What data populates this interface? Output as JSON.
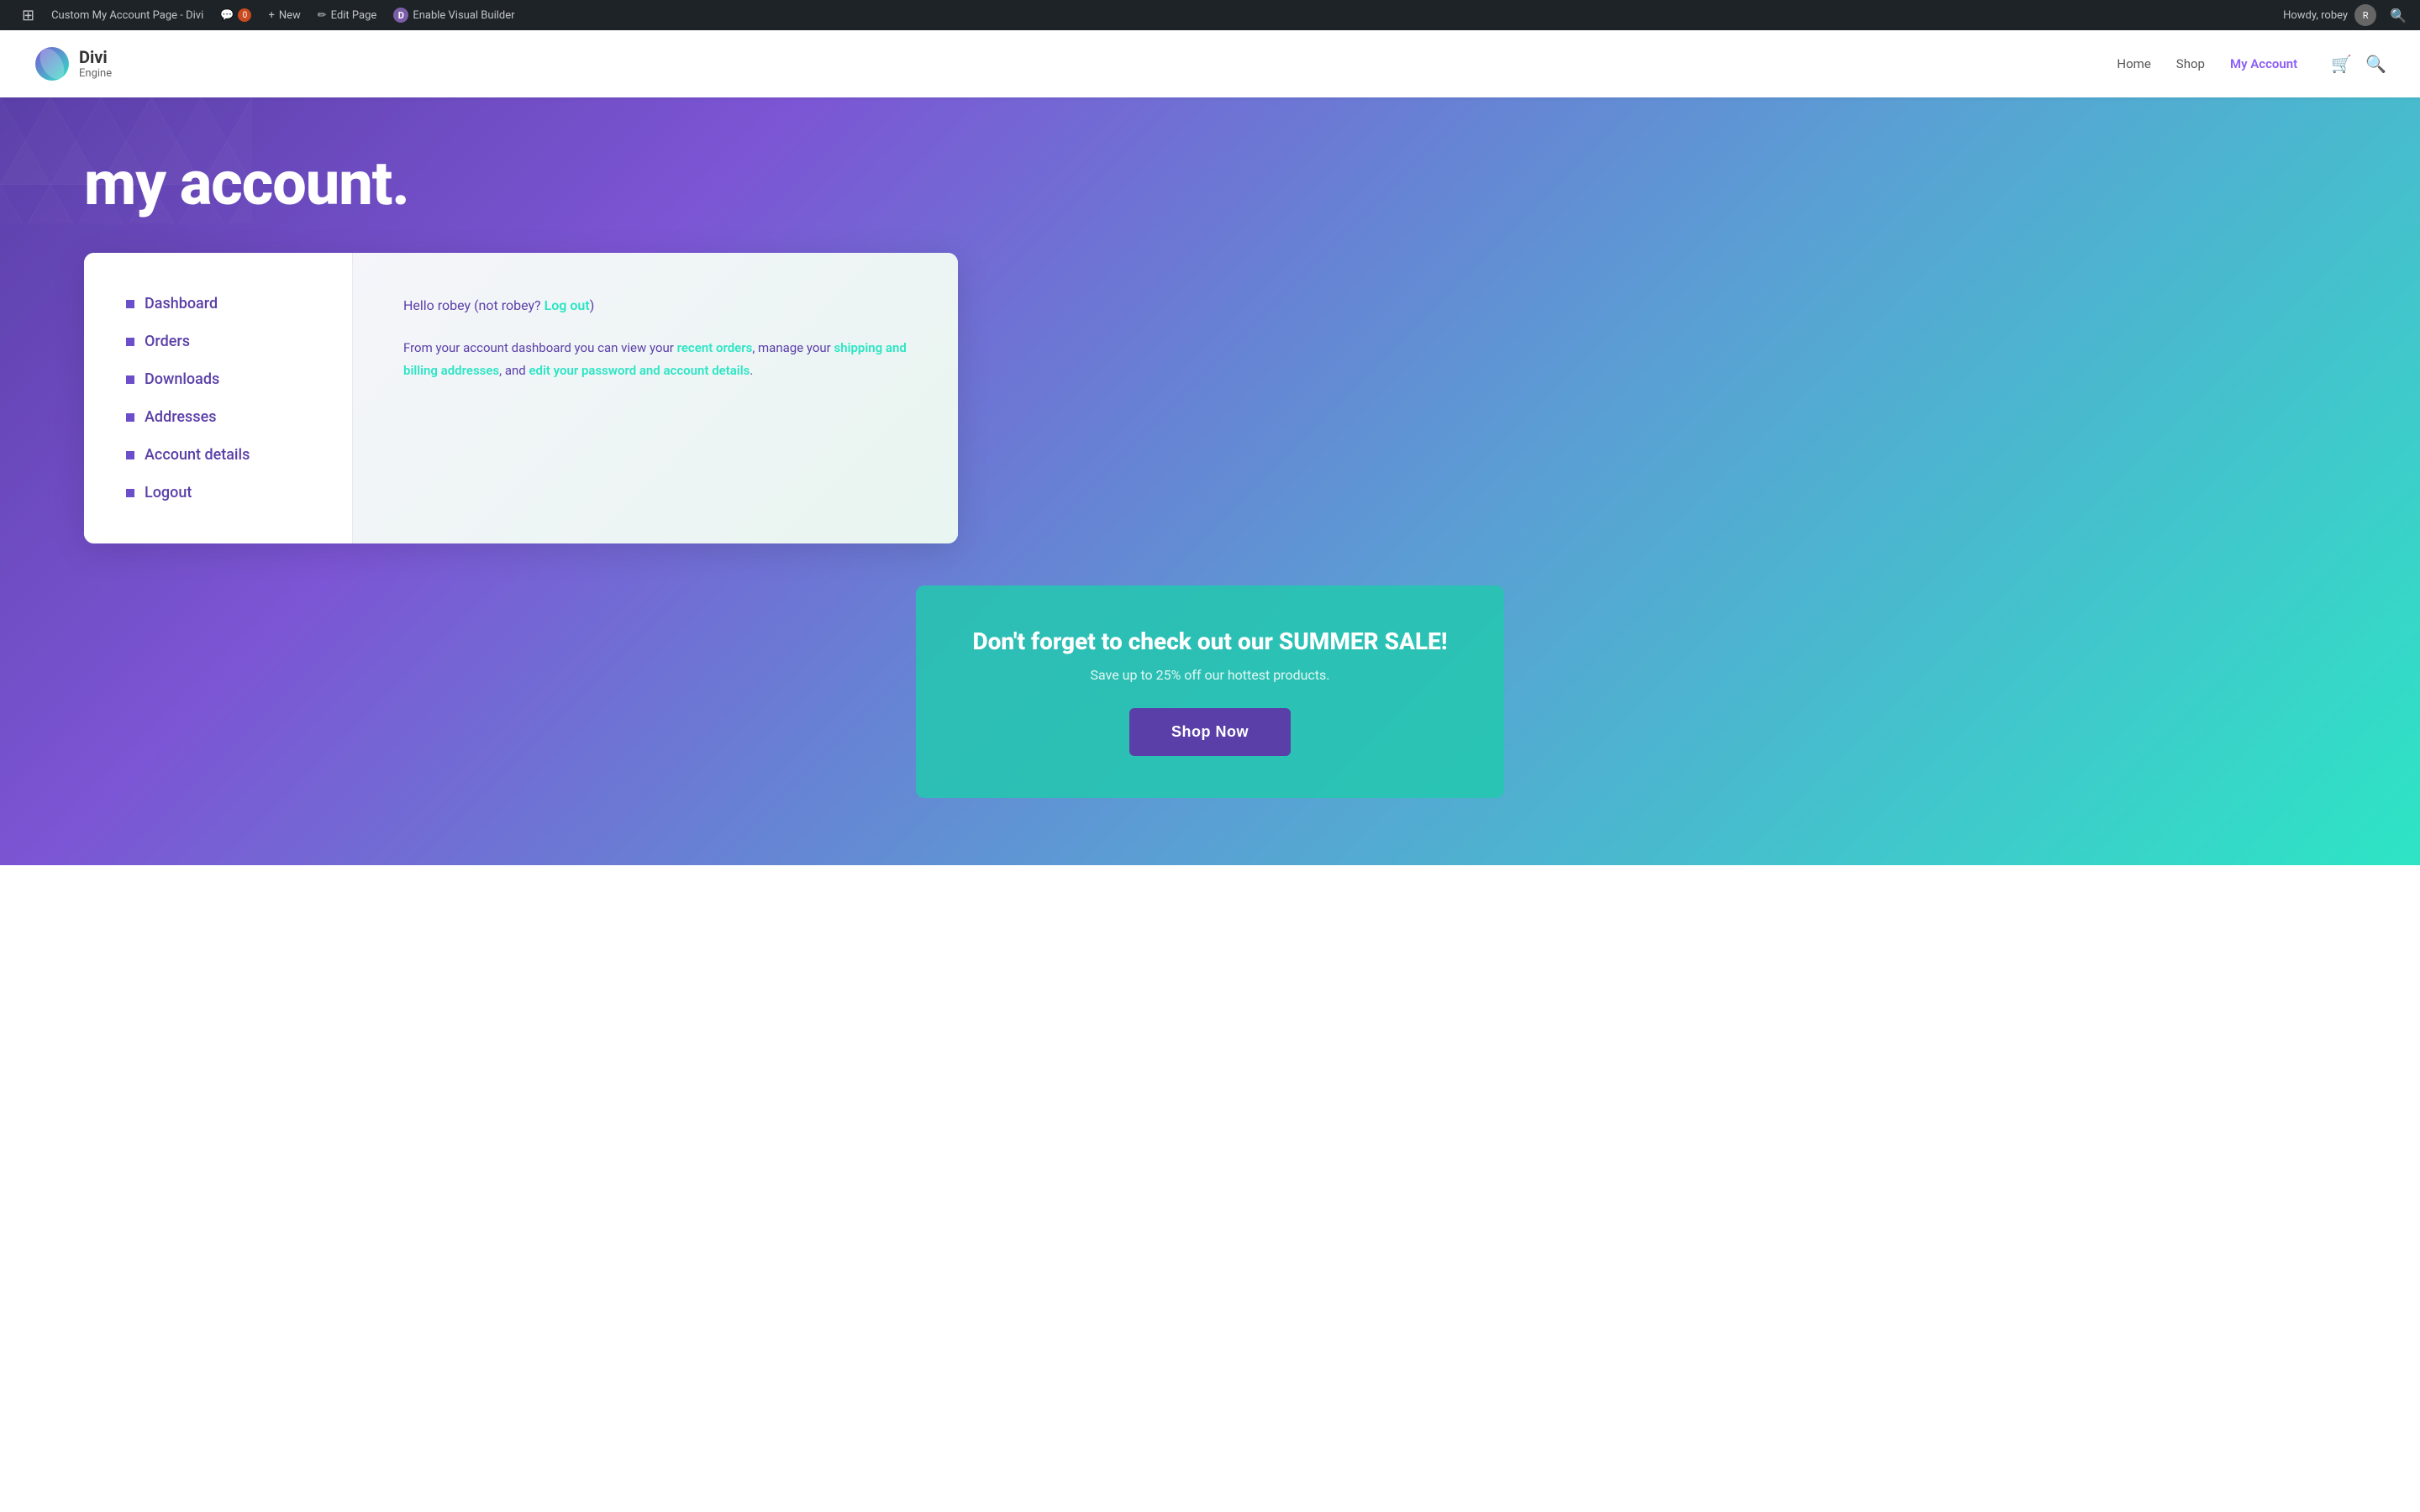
{
  "adminBar": {
    "title": "Custom My Account Page - Divi",
    "items": [
      {
        "id": "wp-logo",
        "label": "WordPress",
        "icon": "⊞"
      },
      {
        "id": "site-name",
        "label": "Custom My Account Page - Divi",
        "icon": ""
      },
      {
        "id": "comments",
        "label": "0",
        "icon": "💬"
      },
      {
        "id": "new",
        "label": "New",
        "icon": "+"
      },
      {
        "id": "edit-page",
        "label": "Edit Page",
        "icon": "✏"
      },
      {
        "id": "divi",
        "label": "Enable Visual Builder",
        "icon": "D"
      }
    ],
    "right": {
      "howdy": "Howdy, robey",
      "avatar_initials": "R"
    }
  },
  "siteHeader": {
    "logo": {
      "divi": "Divi",
      "engine": "Engine"
    },
    "nav": [
      {
        "id": "home",
        "label": "Home",
        "active": false
      },
      {
        "id": "shop",
        "label": "Shop",
        "active": false
      },
      {
        "id": "my-account",
        "label": "My Account",
        "active": true
      }
    ],
    "cart_icon": "🛒",
    "search_icon": "🔍"
  },
  "hero": {
    "title": "my account."
  },
  "accountCard": {
    "sidebar": {
      "items": [
        {
          "id": "dashboard",
          "label": "Dashboard"
        },
        {
          "id": "orders",
          "label": "Orders"
        },
        {
          "id": "downloads",
          "label": "Downloads"
        },
        {
          "id": "addresses",
          "label": "Addresses"
        },
        {
          "id": "account-details",
          "label": "Account details"
        },
        {
          "id": "logout",
          "label": "Logout"
        }
      ]
    },
    "main": {
      "hello_prefix": "Hello robey (not robey? ",
      "logout_link": "Log out",
      "hello_suffix": ")",
      "desc_prefix": "From your account dashboard you can view your ",
      "link1": "recent orders",
      "desc_mid1": ", manage your ",
      "link2": "shipping and billing addresses",
      "desc_mid2": ", and ",
      "link3": "edit your password and account details",
      "desc_suffix": "."
    }
  },
  "saleBanner": {
    "title": "Don't forget to check out our SUMMER SALE!",
    "subtitle": "Save up to 25% off our hottest products.",
    "button": "Shop Now"
  }
}
